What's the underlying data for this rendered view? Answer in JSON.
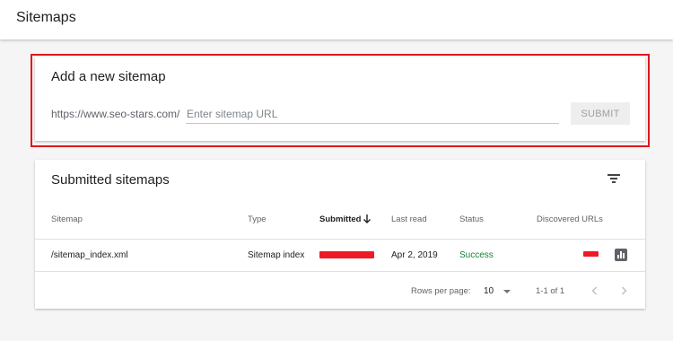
{
  "header": {
    "title": "Sitemaps"
  },
  "add_sitemap": {
    "title": "Add a new sitemap",
    "url_prefix": "https://www.seo-stars.com/",
    "input_placeholder": "Enter sitemap URL",
    "submit_label": "SUBMIT"
  },
  "submitted": {
    "title": "Submitted sitemaps",
    "columns": {
      "sitemap": "Sitemap",
      "type": "Type",
      "submitted": "Submitted",
      "last_read": "Last read",
      "status": "Status",
      "discovered_urls": "Discovered URLs"
    },
    "rows": [
      {
        "sitemap": "/sitemap_index.xml",
        "type": "Sitemap index",
        "last_read": "Apr 2, 2019",
        "status": "Success"
      }
    ],
    "pagination": {
      "rows_per_page_label": "Rows per page:",
      "rows_per_page": "10",
      "range": "1-1 of 1"
    }
  },
  "colors": {
    "highlight_outline": "#e0161b",
    "success": "#188038",
    "redaction": "#ee1b24"
  },
  "icons": [
    "filter-icon",
    "sort-down-arrow-icon",
    "bar-chart-icon",
    "chevron-left-icon",
    "chevron-right-icon",
    "dropdown-arrow-icon"
  ]
}
